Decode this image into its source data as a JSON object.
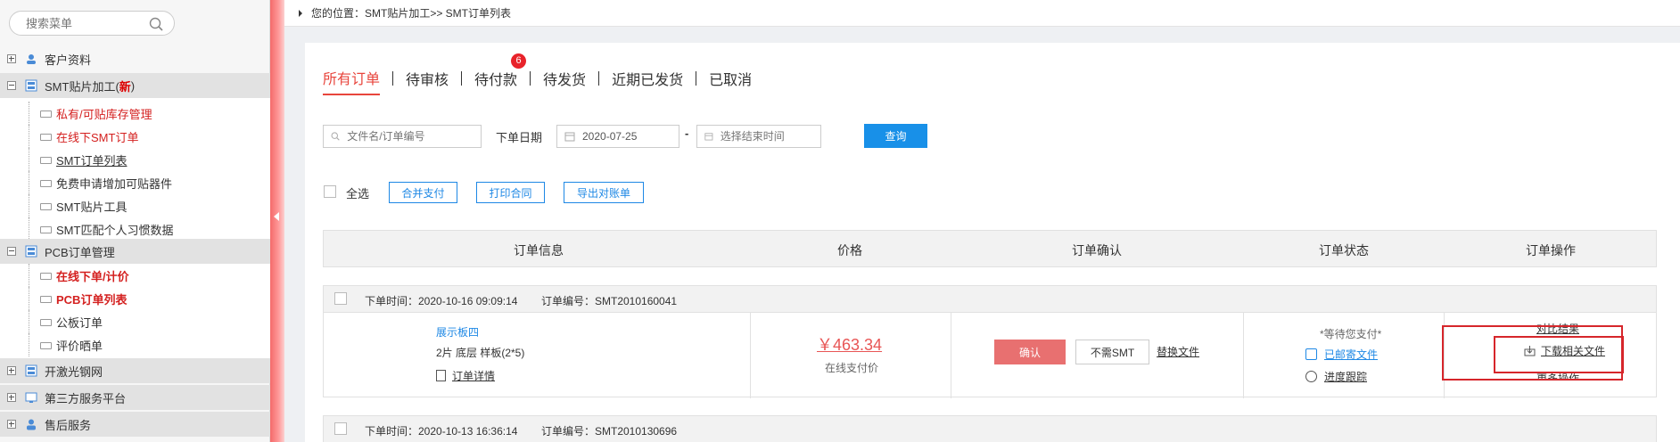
{
  "sidebar": {
    "search_placeholder": "搜索菜单",
    "groups": [
      {
        "label": "客户资料"
      },
      {
        "label": "SMT贴片加工(",
        "new": "新",
        "close": ")"
      },
      {
        "label": "PCB订单管理"
      },
      {
        "label": "开激光钢网"
      },
      {
        "label": "第三方服务平台"
      },
      {
        "label": "售后服务"
      }
    ],
    "smt_items": [
      {
        "label": "私有/可贴库存管理"
      },
      {
        "label": "在线下SMT订单"
      },
      {
        "label": "SMT订单列表"
      },
      {
        "label": "免费申请增加可贴器件"
      },
      {
        "label": "SMT贴片工具"
      },
      {
        "label": "SMT匹配个人习惯数据"
      }
    ],
    "pcb_items": [
      {
        "label": "在线下单/计价"
      },
      {
        "label": "PCB订单列表"
      },
      {
        "label": "公板订单"
      },
      {
        "label": "评价晒单"
      }
    ]
  },
  "breadcrumb": {
    "text": "您的位置：SMT贴片加工>> SMT订单列表"
  },
  "tabs": [
    {
      "label": "所有订单"
    },
    {
      "label": "待审核"
    },
    {
      "label": "待付款",
      "badge": "6"
    },
    {
      "label": "待发货"
    },
    {
      "label": "近期已发货"
    },
    {
      "label": "已取消"
    }
  ],
  "filters": {
    "order_search_placeholder": "文件名/订单编号",
    "date_label": "下单日期",
    "start_date": "2020-07-25",
    "dash": "-",
    "end_date_placeholder": "选择结束时间",
    "query_label": "查询"
  },
  "actions": {
    "select_all": "全选",
    "merge_pay": "合并支付",
    "print_contract": "打印合同",
    "export_statement": "导出对账单"
  },
  "table_headers": [
    "订单信息",
    "价格",
    "订单确认",
    "订单状态",
    "订单操作"
  ],
  "orders": [
    {
      "time": "下单时间：2020-10-16 09:09:14",
      "order_no": "订单编号：SMT2010160041",
      "product": "展示板四",
      "spec": "2片 底层 样板(2*5)",
      "detail": "订单详情",
      "price": "￥463.34",
      "price_note": "在线支付价",
      "confirm": "确认",
      "no_smt": "不需SMT",
      "replace_file": "替换文件",
      "status": "*等待您支付*",
      "mail_file": "已邮寄文件",
      "progress": "进度跟踪",
      "op_compare": "对比结果",
      "op_download": "下载相关文件",
      "op_more": "更多操作"
    },
    {
      "time": "下单时间：2020-10-13 16:36:14",
      "order_no": "订单编号：SMT2010130696"
    }
  ]
}
